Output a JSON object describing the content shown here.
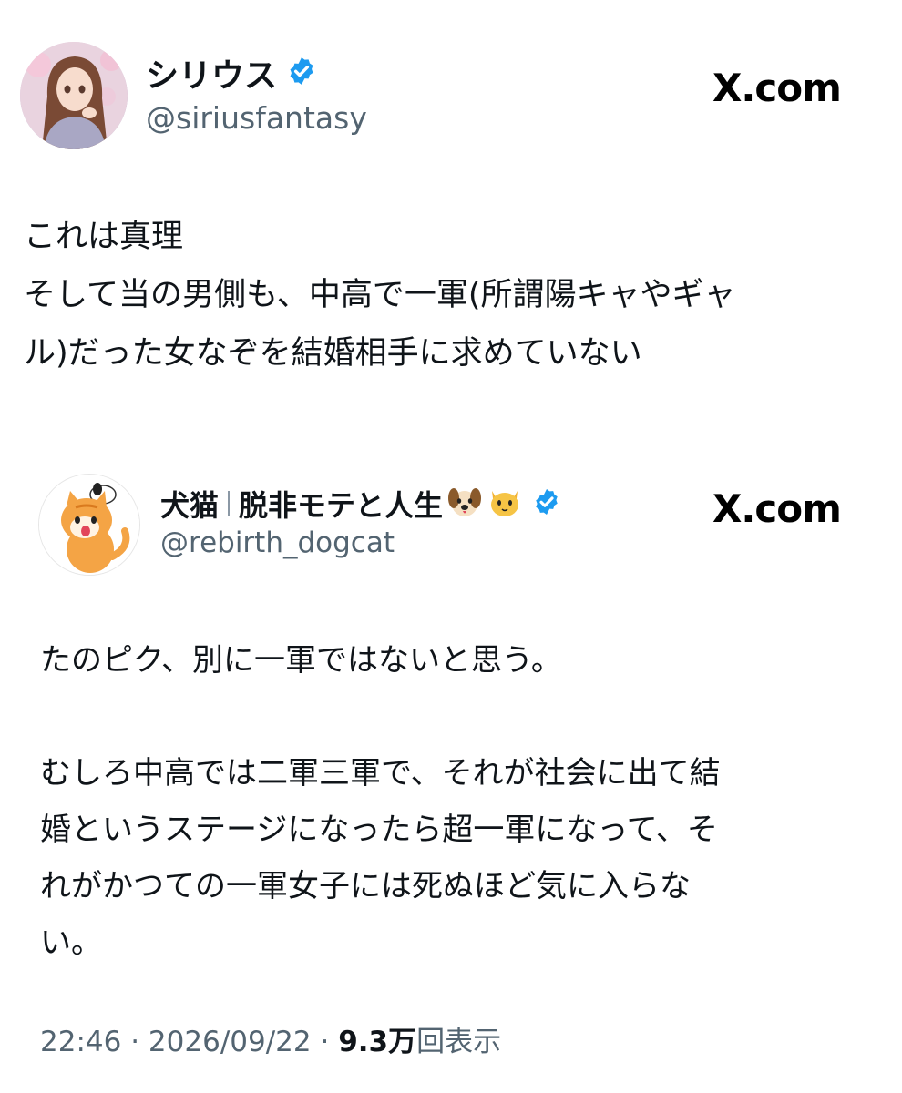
{
  "main_tweet": {
    "display_name": "シリウス",
    "handle": "@siriusfantasy",
    "source_label": "X.com",
    "text_lines": [
      "これは真理",
      "そして当の男側も、中高で一軍(所謂陽キャやギャ",
      "ル)だった女なぞを結婚相手に求めていない"
    ]
  },
  "quoted_tweet": {
    "display_name_part1": "犬猫",
    "display_name_part2": "脱非モテと人生",
    "handle": "@rebirth_dogcat",
    "source_label": "X.com",
    "paragraph1_lines": [
      "たのピク、別に一軍ではないと思う。"
    ],
    "paragraph2_lines": [
      "むしろ中高では二軍三軍で、それが社会に出て結",
      "婚というステージになったら超一軍になって、そ",
      "れがかつての一軍女子には死ぬほど気に入らな",
      "い。"
    ]
  },
  "footer": {
    "time": "22:46",
    "separator": "·",
    "date": "2026/09/22",
    "views_number": "9.3万",
    "views_label": "回表示"
  },
  "colors": {
    "verified_blue": "#1d9bf0",
    "secondary_text": "#536471",
    "primary_text": "#0f1419"
  },
  "icons": {
    "verified": "verified-badge-icon",
    "dog_emoji": "dog-face-emoji",
    "cat_emoji": "cat-face-emoji"
  }
}
